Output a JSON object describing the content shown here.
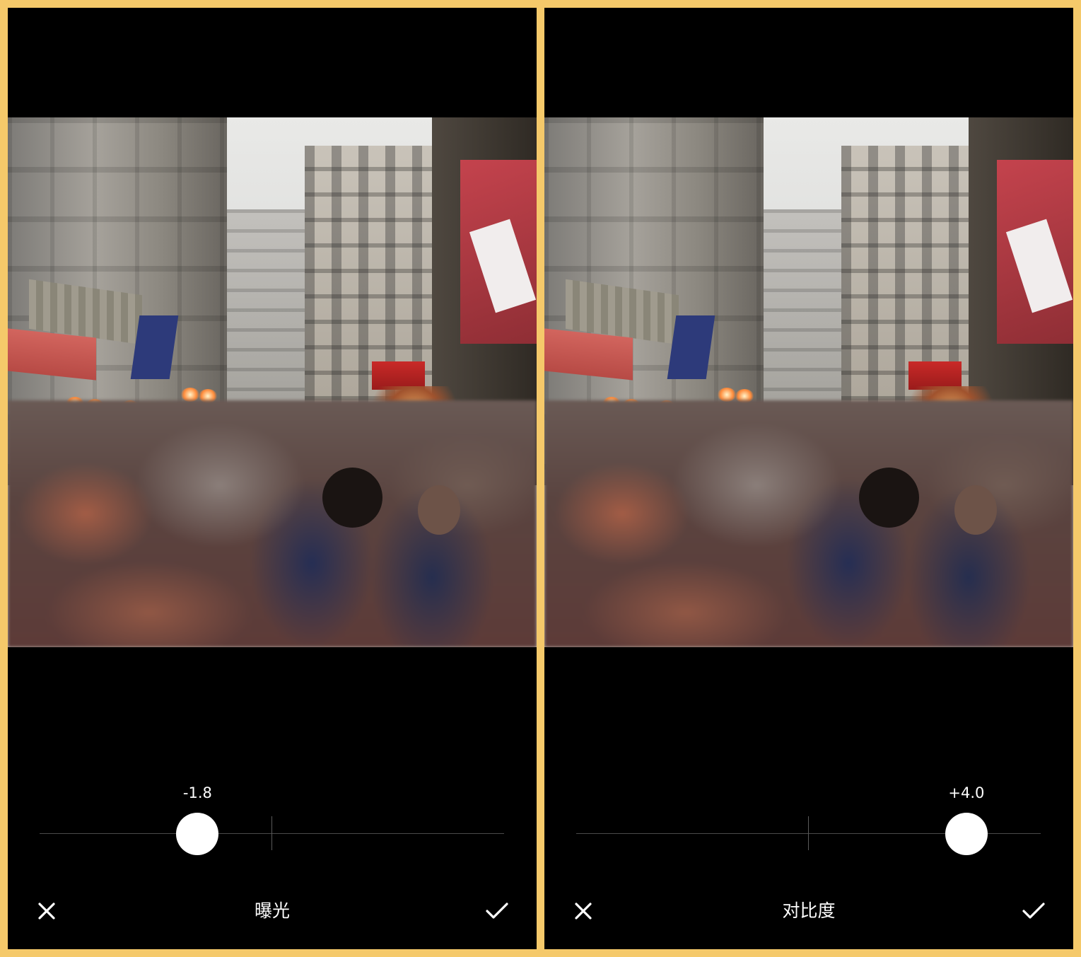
{
  "panels": [
    {
      "tool_label": "曝光",
      "slider_value_text": "-1.8",
      "slider_position_fraction": 0.34,
      "cancel_icon": "close-icon",
      "confirm_icon": "check-icon"
    },
    {
      "tool_label": "对比度",
      "slider_value_text": "+4.0",
      "slider_position_fraction": 0.84,
      "cancel_icon": "close-icon",
      "confirm_icon": "check-icon"
    }
  ],
  "colors": {
    "frame": "#f5c96a",
    "background": "#000000",
    "knob": "#ffffff",
    "track": "#4a4a4a"
  }
}
